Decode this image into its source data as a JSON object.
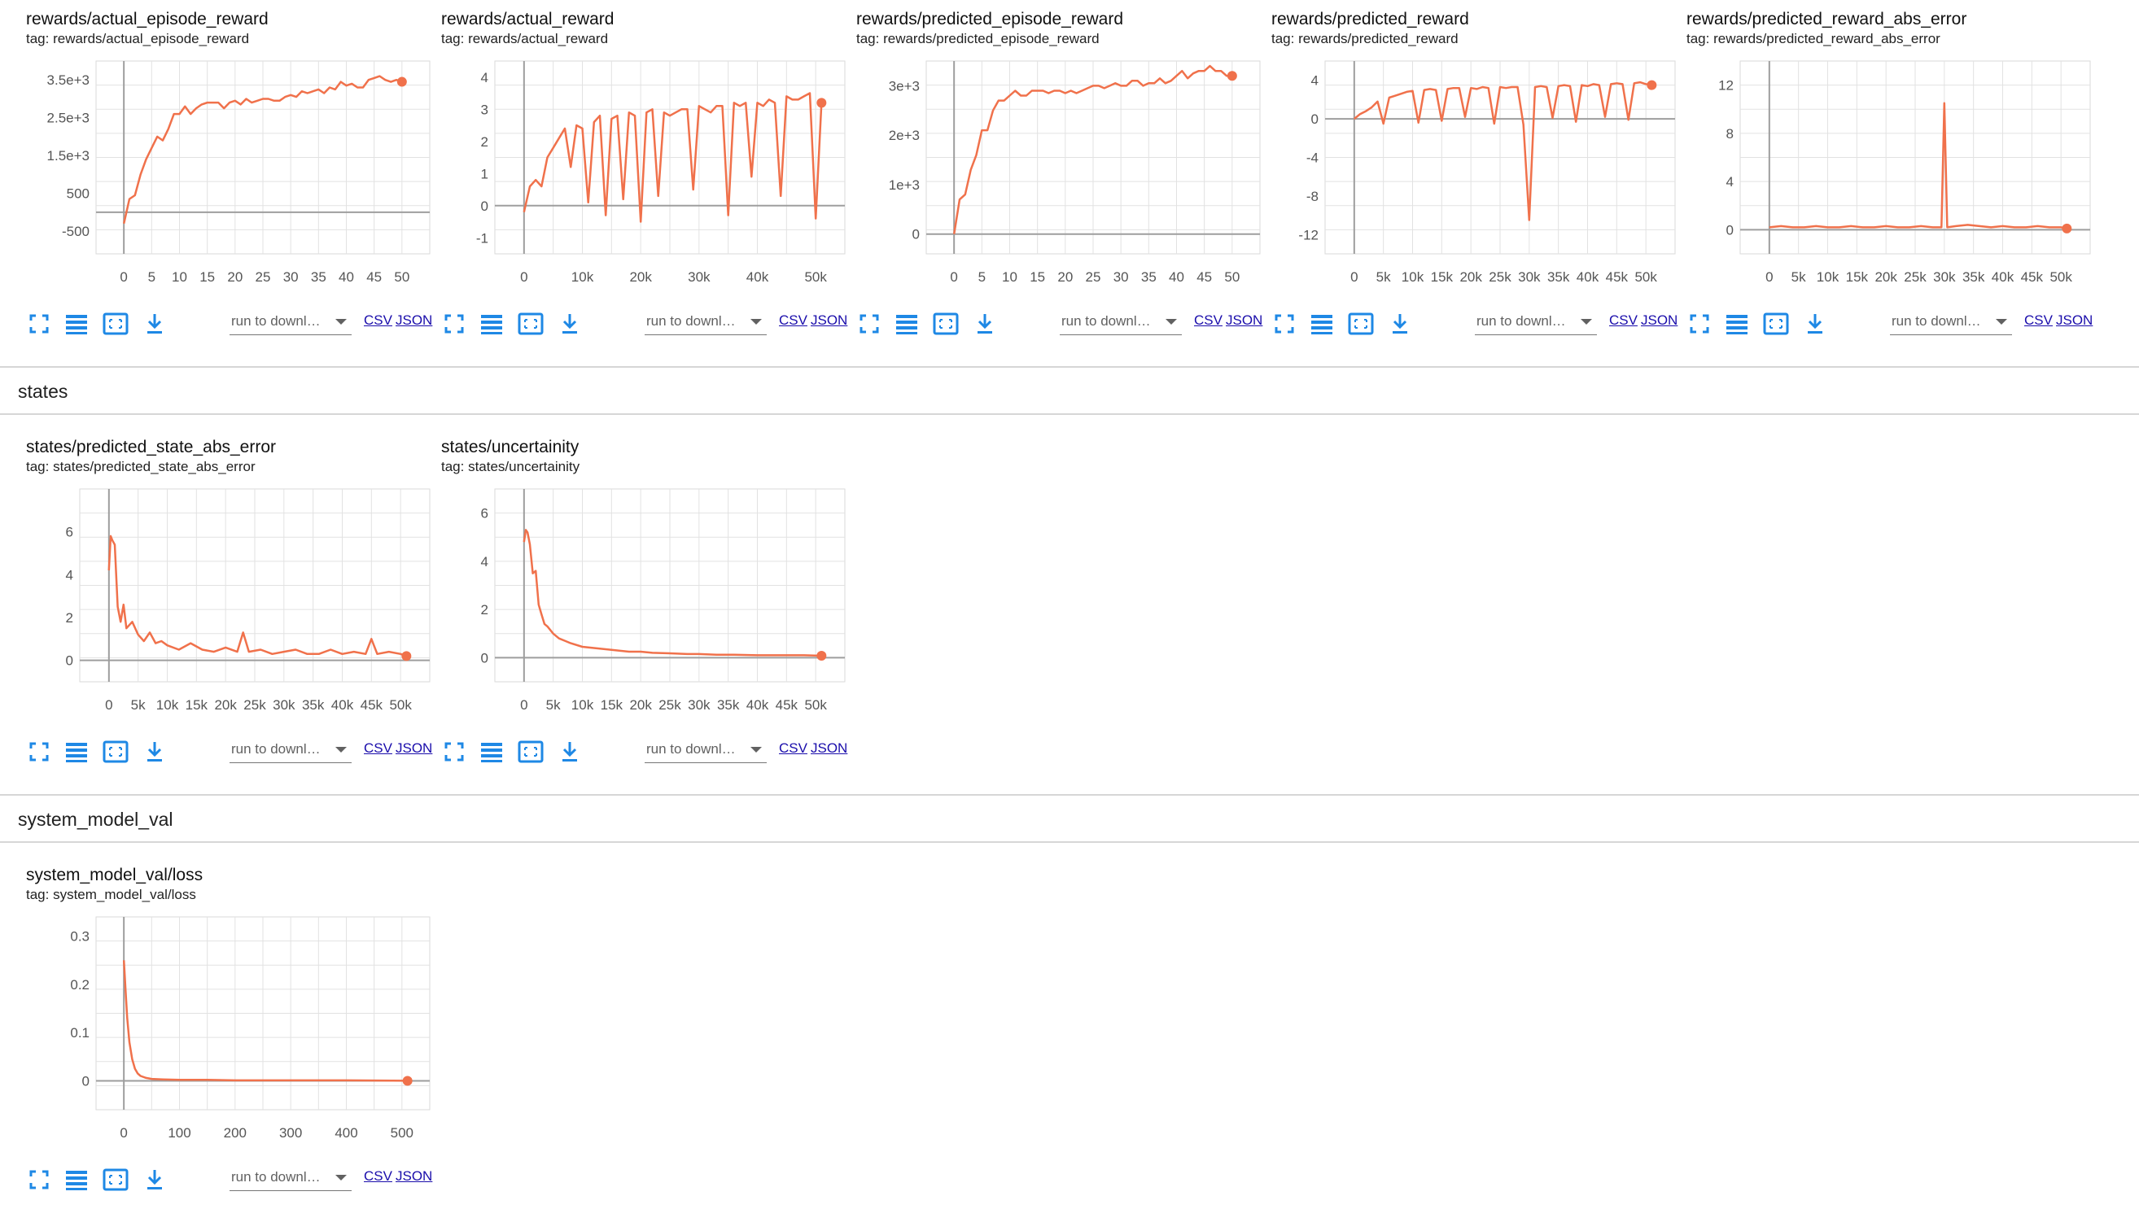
{
  "sections": [
    {
      "id": "rewards",
      "title": ""
    },
    {
      "id": "states",
      "title": "states"
    },
    {
      "id": "system_model_val",
      "title": "system_model_val"
    }
  ],
  "toolbar": {
    "run_select_label": "run to downl…",
    "csv_label": "CSV",
    "json_label": "JSON"
  },
  "accent_color": "#f0714b",
  "cards": [
    {
      "title": "rewards/actual_episode_reward",
      "tag": "tag: rewards/actual_episode_reward",
      "chart_data": {
        "type": "line",
        "x": [
          0,
          1,
          2,
          3,
          4,
          5,
          6,
          7,
          8,
          9,
          10,
          11,
          12,
          13,
          14,
          15,
          16,
          17,
          18,
          19,
          20,
          21,
          22,
          23,
          24,
          25,
          26,
          27,
          28,
          29,
          30,
          31,
          32,
          33,
          34,
          35,
          36,
          37,
          38,
          39,
          40,
          41,
          42,
          43,
          44,
          45,
          46,
          47,
          48,
          49,
          50
        ],
        "values": [
          -300,
          350,
          450,
          1000,
          1400,
          1700,
          2000,
          1900,
          2200,
          2600,
          2600,
          2800,
          2600,
          2750,
          2850,
          2900,
          2900,
          2900,
          2750,
          2900,
          2950,
          2850,
          3000,
          2900,
          2950,
          3000,
          3000,
          2950,
          2950,
          3050,
          3100,
          3050,
          3200,
          3150,
          3200,
          3250,
          3150,
          3300,
          3250,
          3450,
          3350,
          3400,
          3300,
          3300,
          3500,
          3550,
          3600,
          3500,
          3450,
          3500,
          3450
        ],
        "xlim": [
          -5,
          55
        ],
        "ylim": [
          -1100,
          4000
        ],
        "xticks": [
          "0",
          "5",
          "10",
          "15",
          "20",
          "25",
          "30",
          "35",
          "40",
          "45",
          "50"
        ],
        "yticks": [
          "-500",
          "500",
          "1.5e+3",
          "2.5e+3",
          "3.5e+3"
        ],
        "ytick_values": [
          -500,
          500,
          1500,
          2500,
          3500
        ]
      }
    },
    {
      "title": "rewards/actual_reward",
      "tag": "tag: rewards/actual_reward",
      "chart_data": {
        "type": "line",
        "x": [
          0,
          1000,
          2000,
          3000,
          4000,
          5000,
          6000,
          7000,
          8000,
          9000,
          10000,
          11000,
          12000,
          13000,
          14000,
          15000,
          16000,
          17000,
          18000,
          19000,
          20000,
          21000,
          22000,
          23000,
          24000,
          25000,
          26000,
          27000,
          28000,
          29000,
          30000,
          31000,
          32000,
          33000,
          34000,
          35000,
          36000,
          37000,
          38000,
          39000,
          40000,
          41000,
          42000,
          43000,
          44000,
          45000,
          46000,
          47000,
          48000,
          49000,
          50000,
          51000
        ],
        "values": [
          -0.2,
          0.6,
          0.8,
          0.6,
          1.5,
          1.8,
          2.1,
          2.4,
          1.2,
          2.5,
          2.4,
          0.1,
          2.6,
          2.8,
          -0.3,
          2.7,
          2.8,
          0.2,
          2.9,
          2.8,
          -0.5,
          2.9,
          3.0,
          0.3,
          2.9,
          2.8,
          2.9,
          3.0,
          3.0,
          0.5,
          3.1,
          3.0,
          2.9,
          3.1,
          3.1,
          -0.3,
          3.2,
          3.1,
          3.2,
          0.9,
          3.2,
          3.1,
          3.3,
          3.2,
          0.3,
          3.4,
          3.3,
          3.3,
          3.4,
          3.5,
          -0.4,
          3.2
        ],
        "xlim": [
          -5000,
          55000
        ],
        "ylim": [
          -1.5,
          4.5
        ],
        "xticks": [
          "0",
          "10k",
          "20k",
          "30k",
          "40k",
          "50k"
        ],
        "yticks": [
          "-1",
          "0",
          "1",
          "2",
          "3",
          "4"
        ],
        "ytick_values": [
          -1,
          0,
          1,
          2,
          3,
          4
        ]
      }
    },
    {
      "title": "rewards/predicted_episode_reward",
      "tag": "tag: rewards/predicted_episode_reward",
      "chart_data": {
        "type": "line",
        "x": [
          0,
          1,
          2,
          3,
          4,
          5,
          6,
          7,
          8,
          9,
          10,
          11,
          12,
          13,
          14,
          15,
          16,
          17,
          18,
          19,
          20,
          21,
          22,
          23,
          24,
          25,
          26,
          27,
          28,
          29,
          30,
          31,
          32,
          33,
          34,
          35,
          36,
          37,
          38,
          39,
          40,
          41,
          42,
          43,
          44,
          45,
          46,
          47,
          48,
          49,
          50
        ],
        "values": [
          0,
          700,
          800,
          1300,
          1600,
          2100,
          2100,
          2500,
          2700,
          2700,
          2800,
          2900,
          2800,
          2800,
          2900,
          2900,
          2900,
          2850,
          2900,
          2900,
          2850,
          2900,
          2850,
          2900,
          2950,
          3000,
          3000,
          2950,
          3000,
          3050,
          3000,
          3000,
          3100,
          3100,
          3000,
          3050,
          3050,
          3150,
          3050,
          3100,
          3200,
          3300,
          3150,
          3250,
          3300,
          3300,
          3400,
          3300,
          3300,
          3200,
          3200
        ],
        "xlim": [
          -5,
          55
        ],
        "ylim": [
          -400,
          3500
        ],
        "xticks": [
          "0",
          "5",
          "10",
          "15",
          "20",
          "25",
          "30",
          "35",
          "40",
          "45",
          "50"
        ],
        "yticks": [
          "0",
          "1e+3",
          "2e+3",
          "3e+3"
        ],
        "ytick_values": [
          0,
          1000,
          2000,
          3000
        ]
      }
    },
    {
      "title": "rewards/predicted_reward",
      "tag": "tag: rewards/predicted_reward",
      "chart_data": {
        "type": "line",
        "x": [
          0,
          1000,
          2000,
          3000,
          4000,
          5000,
          6000,
          7000,
          8000,
          9000,
          10000,
          11000,
          12000,
          13000,
          14000,
          15000,
          16000,
          17000,
          18000,
          19000,
          20000,
          21000,
          22000,
          23000,
          24000,
          25000,
          26000,
          27000,
          28000,
          29000,
          30000,
          31000,
          32000,
          33000,
          34000,
          35000,
          36000,
          37000,
          38000,
          39000,
          40000,
          41000,
          42000,
          43000,
          44000,
          45000,
          46000,
          47000,
          48000,
          49000,
          50000,
          51000
        ],
        "values": [
          0,
          0.5,
          0.8,
          1.2,
          1.8,
          -0.5,
          2.2,
          2.4,
          2.6,
          2.8,
          2.9,
          -0.4,
          3.0,
          3.1,
          3.0,
          -0.2,
          3.1,
          3.2,
          3.2,
          0.2,
          3.2,
          3.1,
          3.3,
          3.2,
          -0.5,
          3.3,
          3.2,
          3.3,
          3.3,
          -0.6,
          -10.5,
          3.3,
          3.4,
          3.3,
          0.1,
          3.4,
          3.5,
          3.4,
          -0.3,
          3.5,
          3.4,
          3.6,
          3.5,
          0.2,
          3.6,
          3.7,
          3.6,
          -0.1,
          3.7,
          3.8,
          3.6,
          3.5
        ],
        "xlim": [
          -5000,
          55000
        ],
        "ylim": [
          -14,
          6
        ],
        "xticks": [
          "0",
          "5k",
          "10k",
          "15k",
          "20k",
          "25k",
          "30k",
          "35k",
          "40k",
          "45k",
          "50k"
        ],
        "yticks": [
          "-12",
          "-8",
          "-4",
          "0",
          "4"
        ],
        "ytick_values": [
          -12,
          -8,
          -4,
          0,
          4
        ]
      }
    },
    {
      "title": "rewards/predicted_reward_abs_error",
      "tag": "tag: rewards/predicted_reward_abs_error",
      "chart_data": {
        "type": "line",
        "x": [
          0,
          2000,
          4000,
          6000,
          8000,
          10000,
          12000,
          14000,
          16000,
          18000,
          20000,
          22000,
          24000,
          26000,
          28000,
          29500,
          30000,
          30500,
          32000,
          34000,
          36000,
          38000,
          40000,
          42000,
          44000,
          46000,
          48000,
          50000,
          51000
        ],
        "values": [
          0.2,
          0.3,
          0.2,
          0.2,
          0.3,
          0.2,
          0.2,
          0.3,
          0.2,
          0.2,
          0.3,
          0.2,
          0.2,
          0.3,
          0.2,
          0.2,
          10.5,
          0.2,
          0.3,
          0.4,
          0.3,
          0.2,
          0.3,
          0.2,
          0.2,
          0.3,
          0.2,
          0.2,
          0.1
        ],
        "xlim": [
          -5000,
          55000
        ],
        "ylim": [
          -2,
          14
        ],
        "xticks": [
          "0",
          "5k",
          "10k",
          "15k",
          "20k",
          "25k",
          "30k",
          "35k",
          "40k",
          "45k",
          "50k"
        ],
        "yticks": [
          "0",
          "4",
          "8",
          "12"
        ],
        "ytick_values": [
          0,
          4,
          8,
          12
        ]
      }
    },
    {
      "title": "states/predicted_state_abs_error",
      "tag": "tag: states/predicted_state_abs_error",
      "chart_data": {
        "type": "line",
        "x": [
          0,
          300,
          600,
          1000,
          1500,
          2000,
          2500,
          3000,
          4000,
          5000,
          6000,
          7000,
          8000,
          9000,
          10000,
          12000,
          14000,
          16000,
          18000,
          20000,
          22000,
          23000,
          24000,
          26000,
          28000,
          30000,
          32000,
          34000,
          36000,
          38000,
          40000,
          42000,
          44000,
          45000,
          46000,
          48000,
          50000,
          51000
        ],
        "values": [
          4.2,
          5.8,
          5.6,
          5.4,
          2.5,
          1.8,
          2.6,
          1.5,
          1.8,
          1.2,
          0.9,
          1.3,
          0.8,
          0.9,
          0.7,
          0.5,
          0.8,
          0.5,
          0.4,
          0.6,
          0.4,
          1.3,
          0.4,
          0.5,
          0.3,
          0.4,
          0.5,
          0.3,
          0.3,
          0.5,
          0.3,
          0.4,
          0.3,
          1.0,
          0.3,
          0.4,
          0.3,
          0.2
        ],
        "xlim": [
          -5000,
          55000
        ],
        "ylim": [
          -1,
          8
        ],
        "xticks": [
          "0",
          "5k",
          "10k",
          "15k",
          "20k",
          "25k",
          "30k",
          "35k",
          "40k",
          "45k",
          "50k"
        ],
        "yticks": [
          "0",
          "2",
          "4",
          "6"
        ],
        "ytick_values": [
          0,
          2,
          4,
          6
        ]
      }
    },
    {
      "title": "states/uncertainity",
      "tag": "tag: states/uncertainity",
      "chart_data": {
        "type": "line",
        "x": [
          0,
          300,
          600,
          1000,
          1500,
          2000,
          2500,
          3000,
          3500,
          4000,
          5000,
          6000,
          7000,
          8000,
          10000,
          12000,
          14000,
          16000,
          18000,
          20000,
          22000,
          25000,
          28000,
          30000,
          33000,
          36000,
          40000,
          44000,
          48000,
          51000
        ],
        "values": [
          4.8,
          5.3,
          5.2,
          4.7,
          3.5,
          3.6,
          2.2,
          1.8,
          1.4,
          1.3,
          1.0,
          0.8,
          0.7,
          0.6,
          0.45,
          0.4,
          0.35,
          0.3,
          0.25,
          0.25,
          0.2,
          0.18,
          0.15,
          0.15,
          0.12,
          0.12,
          0.1,
          0.1,
          0.1,
          0.08
        ],
        "xlim": [
          -5000,
          55000
        ],
        "ylim": [
          -1,
          7
        ],
        "xticks": [
          "0",
          "5k",
          "10k",
          "15k",
          "20k",
          "25k",
          "30k",
          "35k",
          "40k",
          "45k",
          "50k"
        ],
        "yticks": [
          "0",
          "2",
          "4",
          "6"
        ],
        "ytick_values": [
          0,
          2,
          4,
          6
        ]
      }
    },
    {
      "title": "system_model_val/loss",
      "tag": "tag: system_model_val/loss",
      "chart_data": {
        "type": "line",
        "x": [
          0,
          3,
          6,
          10,
          15,
          20,
          25,
          30,
          40,
          50,
          70,
          100,
          150,
          200,
          300,
          400,
          510
        ],
        "values": [
          0.25,
          0.19,
          0.13,
          0.08,
          0.045,
          0.025,
          0.015,
          0.01,
          0.006,
          0.004,
          0.003,
          0.002,
          0.002,
          0.001,
          0.001,
          0.001,
          0.0
        ],
        "xlim": [
          -50,
          550
        ],
        "ylim": [
          -0.06,
          0.34
        ],
        "xticks": [
          "0",
          "100",
          "200",
          "300",
          "400",
          "500"
        ],
        "yticks": [
          "0",
          "0.1",
          "0.2",
          "0.3"
        ],
        "ytick_values": [
          0,
          0.1,
          0.2,
          0.3
        ]
      }
    }
  ]
}
